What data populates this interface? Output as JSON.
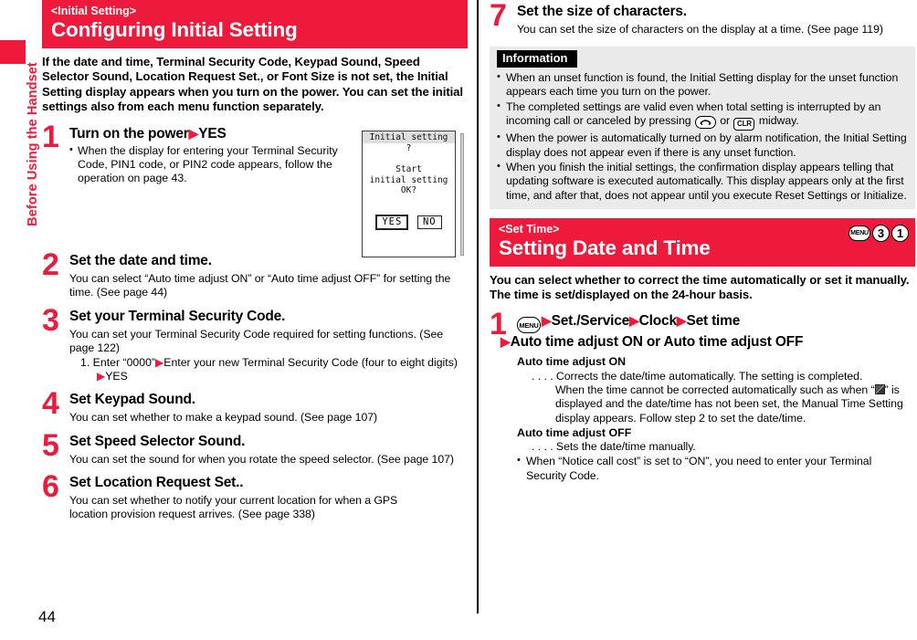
{
  "chapter_tab": {
    "label": "Before Using the Handset",
    "color": "#ed1a3b"
  },
  "page_number": "44",
  "left_column": {
    "banner": {
      "subtitle": "<Initial Setting>",
      "title": "Configuring Initial Setting"
    },
    "intro": "If the date and time, Terminal Security Code, Keypad Sound, Speed Selector Sound, Location Request Set., or Font Size is not set, the Initial Setting display appears when you turn on the power. You can set the initial settings also from each menu function separately.",
    "steps": [
      {
        "number": "1",
        "head_a": "Turn on the power",
        "head_b": "YES",
        "bullet": "When the display for entering your Terminal Security Code, PIN1 code, or PIN2 code appears, follow the operation on page 43."
      },
      {
        "number": "2",
        "head": "Set the date and time.",
        "body": "You can select “Auto time adjust ON” or “Auto time adjust OFF” for setting the time. (See page 44)"
      },
      {
        "number": "3",
        "head": "Set your Terminal Security Code.",
        "body": "You can set your Terminal Security Code required for setting functions. (See page 122)",
        "ordered_a": "1. Enter “0000”",
        "ordered_b": "Enter your new Terminal Security Code (four to eight digits)",
        "ordered_c": "YES"
      },
      {
        "number": "4",
        "head": "Set Keypad Sound.",
        "body": "You can set whether to make a keypad sound. (See page 107)"
      },
      {
        "number": "5",
        "head": "Set Speed Selector Sound.",
        "body": "You can set the sound for when you rotate the speed selector. (See page 107)"
      },
      {
        "number": "6",
        "head": "Set Location Request Set..",
        "body": "You can set whether to notify your current location for when a GPS location provision request arrives. (See page 338)"
      }
    ],
    "phone_mock": {
      "titlebar": "Initial setting",
      "question_mark": "?",
      "message_line1": "Start",
      "message_line2": "initial setting",
      "message_line3": "OK?",
      "choice_yes": "YES",
      "choice_no": "NO"
    }
  },
  "right_column": {
    "step7": {
      "number": "7",
      "head": "Set the size of characters.",
      "body": "You can set the size of characters on the display at a time. (See page 119)"
    },
    "information": {
      "label": "Information",
      "items": [
        {
          "text_a": "When an unset function is found, the Initial Setting display for the unset function appears each time you turn on the power."
        },
        {
          "text_a": "The completed settings are valid even when total setting is interrupted by an incoming call or canceled by pressing ",
          "key1": "end-call-key",
          "mid": " or ",
          "key2": "CLR",
          "text_b": " midway."
        },
        {
          "text_a": "When the power is automatically turned on by alarm notification, the Initial Setting display does not appear even if there is any unset function."
        },
        {
          "text_a": "When you finish the initial settings, the confirmation display appears telling that updating software is executed automatically. This display appears only at the first time, and after that, does not appear until you execute Reset Settings or Initialize."
        }
      ]
    },
    "banner": {
      "subtitle": "<Set Time>",
      "title": "Setting Date and Time",
      "key_sequence": [
        "MENU",
        "3",
        "1"
      ]
    },
    "intro": "You can select whether to correct the time automatically or set it manually. The time is set/displayed on the 24-hour basis.",
    "step1": {
      "number": "1",
      "menu_key": "MENU",
      "head_items": [
        "Set./Service",
        "Clock",
        "Set time"
      ],
      "head_line2": "Auto time adjust ON or Auto time adjust OFF",
      "detail_on_title": "Auto time adjust ON",
      "detail_on_line1": ". . . . Corrects the date/time automatically. The setting is completed.",
      "detail_on_line2a": "When the time cannot be corrected automatically such as when “",
      "detail_on_line2b": "” is",
      "detail_on_line3": "displayed and the date/time has not been set, the Manual Time Setting",
      "detail_on_line4": "display appears. Follow step 2 to set the date/time.",
      "detail_off_title": "Auto time adjust OFF",
      "detail_off_line1": ". . . . Sets the date/time manually.",
      "detail_bullet": "When “Notice call cost” is set to “ON”, you need to enter your Terminal Security Code."
    }
  }
}
